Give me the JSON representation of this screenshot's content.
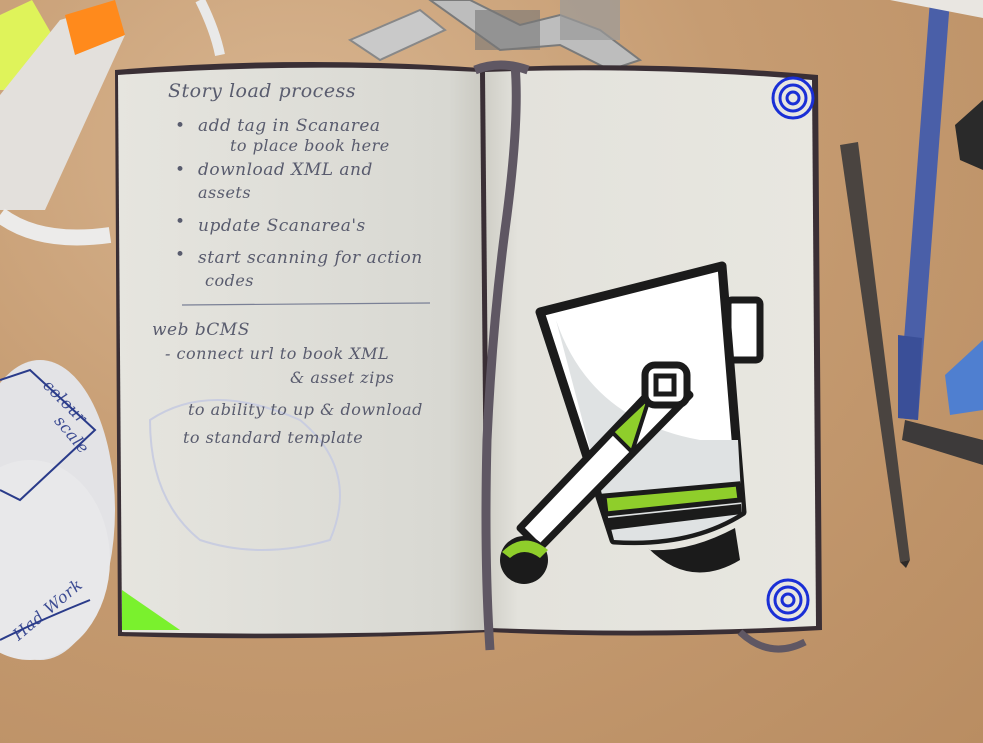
{
  "notebook": {
    "left_page": {
      "heading": "Story load process",
      "bullets": [
        {
          "line1": "add tag in Scanarea",
          "line2": "to place book here"
        },
        {
          "line1": "download XML and",
          "line2": "assets"
        },
        {
          "line1": "update Scanarea's",
          "line2": ""
        },
        {
          "line1": "start scanning for action",
          "line2": "codes"
        }
      ],
      "section2": {
        "heading": "web bCMS",
        "lines": [
          "- connect url to book XML",
          "& asset zips",
          "to ability to up & download",
          "to standard template"
        ]
      }
    },
    "right_page": {
      "robot_alt": "robot illustration",
      "accent_color": "#8fce2b",
      "marker_color": "#1a2fd6"
    }
  },
  "desk_items": {
    "highlighter_color": "#dff35a",
    "pencil_color": "#4a4440",
    "pen_color": "#4a5fa8"
  },
  "coaster": {
    "scribbles": [
      "colour",
      "scale",
      "Had Work"
    ]
  }
}
